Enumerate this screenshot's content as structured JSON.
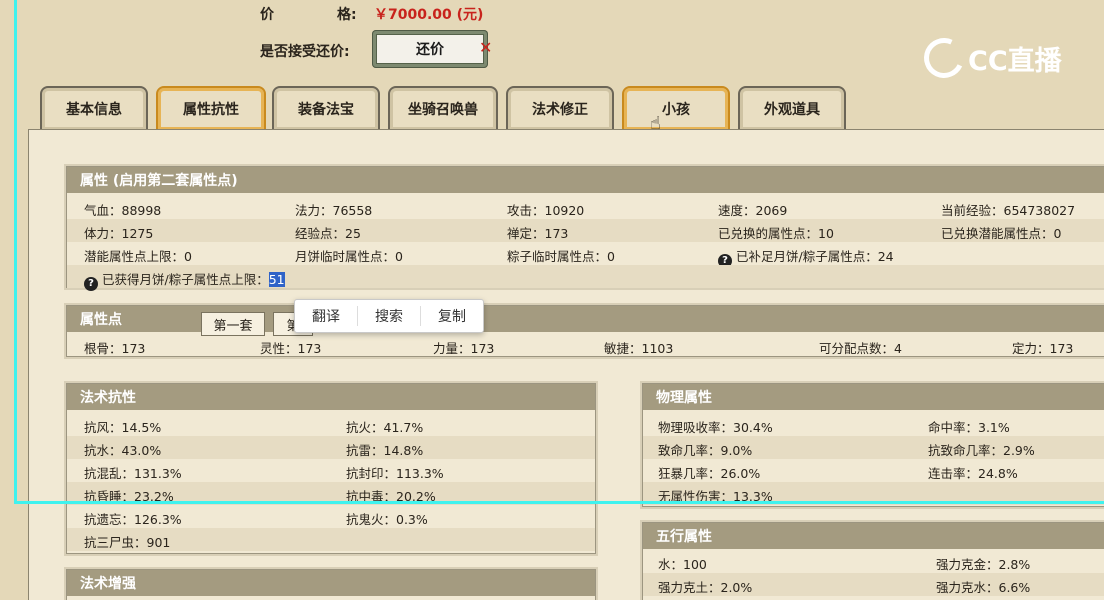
{
  "price": {
    "label_a": "价",
    "label_b": "格:",
    "value": "￥7000.00 (元)"
  },
  "counter": {
    "label": "是否接受还价:",
    "button": "还价"
  },
  "logo": {
    "text": "CC直播"
  },
  "tabs": [
    "基本信息",
    "属性抗性",
    "装备法宝",
    "坐骑召唤兽",
    "法术修正",
    "小孩",
    "外观道具"
  ],
  "attributes": {
    "title": "属性 (启用第二套属性点)",
    "rows": [
      [
        "气血：88998",
        "法力：76558",
        "攻击：10920",
        "速度：2069",
        "当前经验：654738027"
      ],
      [
        "体力：1275",
        "经验点：25",
        "禅定：173",
        "已兑换的属性点：10",
        "已兑换潜能属性点：0"
      ],
      [
        "潜能属性点上限：0",
        "月饼临时属性点：0",
        "粽子临时属性点：0",
        "已补足月饼/粽子属性点：24"
      ]
    ],
    "last_label": "已获得月饼/粽子属性点上限：",
    "last_value": "51"
  },
  "points": {
    "title": "属性点",
    "subtab_1": "第一套",
    "subtab_2": "第",
    "values": [
      "根骨：173",
      "灵性：173",
      "力量：173",
      "敏捷：1103",
      "可分配点数：4",
      "定力：173"
    ]
  },
  "context_menu": [
    "翻译",
    "搜索",
    "复制"
  ],
  "magic_resist": {
    "title": "法术抗性",
    "rows": [
      [
        "抗风：14.5%",
        "抗火：41.7%"
      ],
      [
        "抗水：43.0%",
        "抗雷：14.8%"
      ],
      [
        "抗混乱：131.3%",
        "抗封印：113.3%"
      ],
      [
        "抗昏睡：23.2%",
        "抗中毒：20.2%"
      ],
      [
        "抗遗忘：126.3%",
        "抗鬼火：0.3%"
      ],
      [
        "抗三尸虫：901",
        ""
      ]
    ]
  },
  "physical": {
    "title": "物理属性",
    "rows": [
      [
        "物理吸收率：30.4%",
        "命中率：3.1%"
      ],
      [
        "致命几率：9.0%",
        "抗致命几率：2.9%"
      ],
      [
        "狂暴几率：26.0%",
        "连击率：24.8%"
      ],
      [
        "无属性伤害：13.3%",
        ""
      ]
    ]
  },
  "five_elements": {
    "title": "五行属性",
    "rows": [
      [
        "水：100",
        "强力克金：2.8%"
      ],
      [
        "强力克土：2.0%",
        "强力克水：6.6%"
      ]
    ]
  },
  "magic_boost": {
    "title": "法术增强"
  }
}
